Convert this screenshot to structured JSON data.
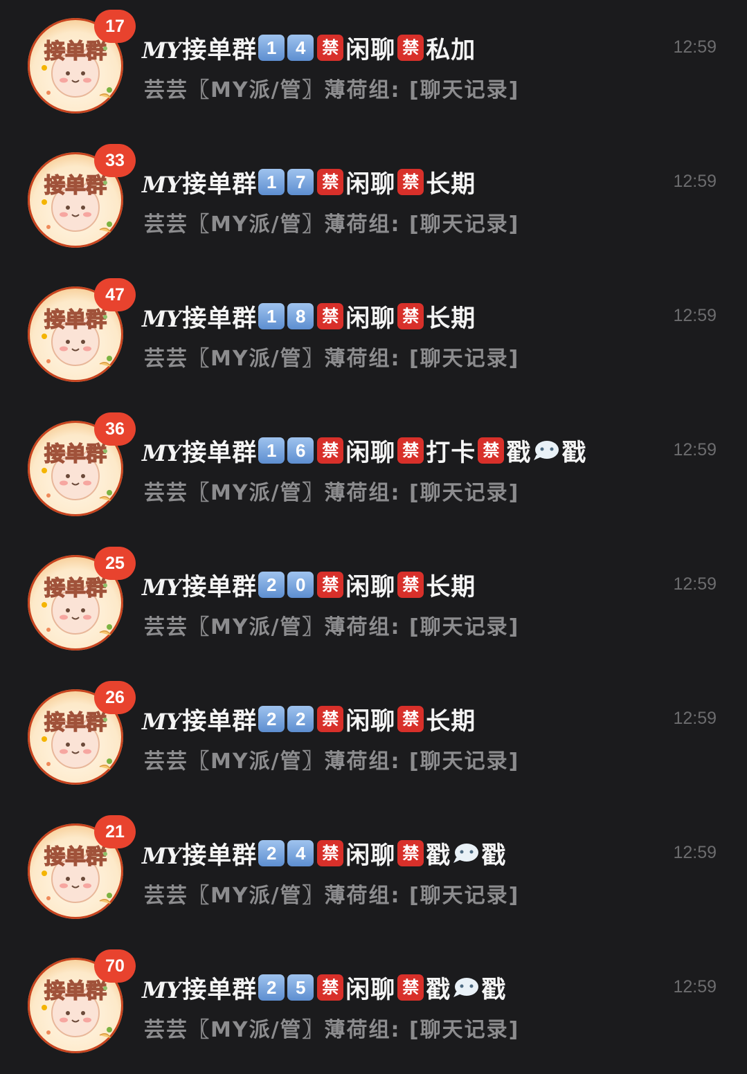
{
  "colors": {
    "background": "#1b1b1d",
    "title_text": "#f4f4f4",
    "preview_text": "#8c8c8e",
    "time_text": "#6c6c6e",
    "badge": "#e8432e",
    "ban_box": "#d8302a",
    "number_box": "#6e9ad6"
  },
  "avatar_icon": "group-avatar-cat-sticker",
  "bubble_icon": "speech-bubble-icon",
  "chats": [
    {
      "badge": "17",
      "title": [
        {
          "type": "text",
          "value": "MY接单群"
        },
        {
          "type": "num",
          "value": "1"
        },
        {
          "type": "num",
          "value": "4"
        },
        {
          "type": "ban",
          "value": "禁"
        },
        {
          "type": "text",
          "value": "闲聊"
        },
        {
          "type": "ban",
          "value": "禁"
        },
        {
          "type": "text",
          "value": "私加"
        }
      ],
      "preview": "芸芸〖MY派/管〗薄荷组: [聊天记录]",
      "time": "12:59"
    },
    {
      "badge": "33",
      "title": [
        {
          "type": "text",
          "value": "MY接单群"
        },
        {
          "type": "num",
          "value": "1"
        },
        {
          "type": "num",
          "value": "7"
        },
        {
          "type": "ban",
          "value": "禁"
        },
        {
          "type": "text",
          "value": "闲聊"
        },
        {
          "type": "ban",
          "value": "禁"
        },
        {
          "type": "text",
          "value": "长期"
        }
      ],
      "preview": "芸芸〖MY派/管〗薄荷组: [聊天记录]",
      "time": "12:59"
    },
    {
      "badge": "47",
      "title": [
        {
          "type": "text",
          "value": "MY接单群"
        },
        {
          "type": "num",
          "value": "1"
        },
        {
          "type": "num",
          "value": "8"
        },
        {
          "type": "ban",
          "value": "禁"
        },
        {
          "type": "text",
          "value": "闲聊"
        },
        {
          "type": "ban",
          "value": "禁"
        },
        {
          "type": "text",
          "value": "长期"
        }
      ],
      "preview": "芸芸〖MY派/管〗薄荷组: [聊天记录]",
      "time": "12:59"
    },
    {
      "badge": "36",
      "title": [
        {
          "type": "text",
          "value": "MY接单群"
        },
        {
          "type": "num",
          "value": "1"
        },
        {
          "type": "num",
          "value": "6"
        },
        {
          "type": "ban",
          "value": "禁"
        },
        {
          "type": "text",
          "value": "闲聊"
        },
        {
          "type": "ban",
          "value": "禁"
        },
        {
          "type": "text",
          "value": "打卡"
        },
        {
          "type": "ban",
          "value": "禁"
        },
        {
          "type": "text",
          "value": "戳"
        },
        {
          "type": "bubble",
          "value": ""
        },
        {
          "type": "text",
          "value": "戳"
        }
      ],
      "preview": "芸芸〖MY派/管〗薄荷组: [聊天记录]",
      "time": "12:59"
    },
    {
      "badge": "25",
      "title": [
        {
          "type": "text",
          "value": "MY接单群"
        },
        {
          "type": "num",
          "value": "2"
        },
        {
          "type": "num",
          "value": "0"
        },
        {
          "type": "ban",
          "value": "禁"
        },
        {
          "type": "text",
          "value": "闲聊"
        },
        {
          "type": "ban",
          "value": "禁"
        },
        {
          "type": "text",
          "value": "长期"
        }
      ],
      "preview": "芸芸〖MY派/管〗薄荷组: [聊天记录]",
      "time": "12:59"
    },
    {
      "badge": "26",
      "title": [
        {
          "type": "text",
          "value": "MY接单群"
        },
        {
          "type": "num",
          "value": "2"
        },
        {
          "type": "num",
          "value": "2"
        },
        {
          "type": "ban",
          "value": "禁"
        },
        {
          "type": "text",
          "value": "闲聊"
        },
        {
          "type": "ban",
          "value": "禁"
        },
        {
          "type": "text",
          "value": "长期"
        }
      ],
      "preview": "芸芸〖MY派/管〗薄荷组: [聊天记录]",
      "time": "12:59"
    },
    {
      "badge": "21",
      "title": [
        {
          "type": "text",
          "value": "MY接单群"
        },
        {
          "type": "num",
          "value": "2"
        },
        {
          "type": "num",
          "value": "4"
        },
        {
          "type": "ban",
          "value": "禁"
        },
        {
          "type": "text",
          "value": "闲聊"
        },
        {
          "type": "ban",
          "value": "禁"
        },
        {
          "type": "text",
          "value": "戳"
        },
        {
          "type": "bubble",
          "value": ""
        },
        {
          "type": "text",
          "value": "戳"
        }
      ],
      "preview": "芸芸〖MY派/管〗薄荷组: [聊天记录]",
      "time": "12:59"
    },
    {
      "badge": "70",
      "title": [
        {
          "type": "text",
          "value": "MY接单群"
        },
        {
          "type": "num",
          "value": "2"
        },
        {
          "type": "num",
          "value": "5"
        },
        {
          "type": "ban",
          "value": "禁"
        },
        {
          "type": "text",
          "value": "闲聊"
        },
        {
          "type": "ban",
          "value": "禁"
        },
        {
          "type": "text",
          "value": "戳"
        },
        {
          "type": "bubble",
          "value": ""
        },
        {
          "type": "text",
          "value": "戳"
        }
      ],
      "preview": "芸芸〖MY派/管〗薄荷组: [聊天记录]",
      "time": "12:59"
    }
  ]
}
